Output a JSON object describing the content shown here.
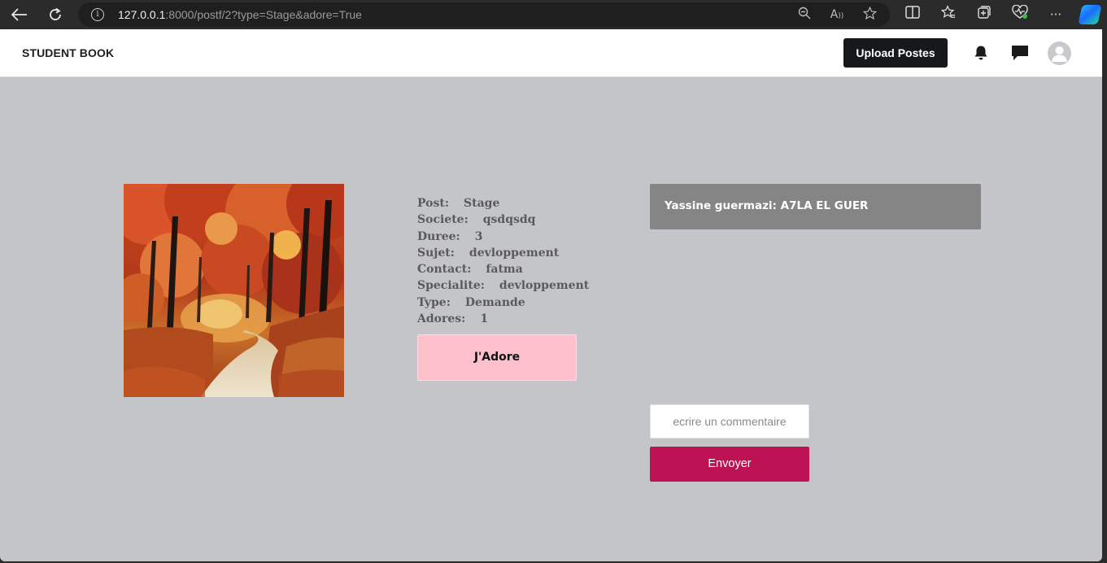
{
  "browser": {
    "url_host": "127.0.0.1",
    "url_rest": ":8000/postf/2?type=Stage&adore=True"
  },
  "nav": {
    "brand": "STUDENT BOOK",
    "upload_label": "Upload Postes"
  },
  "post": {
    "info": [
      {
        "label": "Post:",
        "value": "Stage"
      },
      {
        "label": "Societe:",
        "value": "qsdqsdq"
      },
      {
        "label": "Duree:",
        "value": "3"
      },
      {
        "label": "Sujet:",
        "value": "devloppement"
      },
      {
        "label": "Contact:",
        "value": "fatma"
      },
      {
        "label": "Specialite:",
        "value": "devloppement"
      },
      {
        "label": "Type:",
        "value": "Demande"
      },
      {
        "label": "Adores:",
        "value": "1"
      }
    ],
    "adore_label": "J'Adore"
  },
  "comments": {
    "items": [
      {
        "text": "Yassine guermazi: A7LA EL GUER"
      }
    ],
    "input_placeholder": "ecrire un commentaire",
    "send_label": "Envoyer"
  },
  "colors": {
    "page_bg": "#c4c5c8",
    "adore_bg": "#fec0cb",
    "send_bg": "#bd1254",
    "comment_bg": "#858585",
    "upload_bg": "#17181c"
  }
}
